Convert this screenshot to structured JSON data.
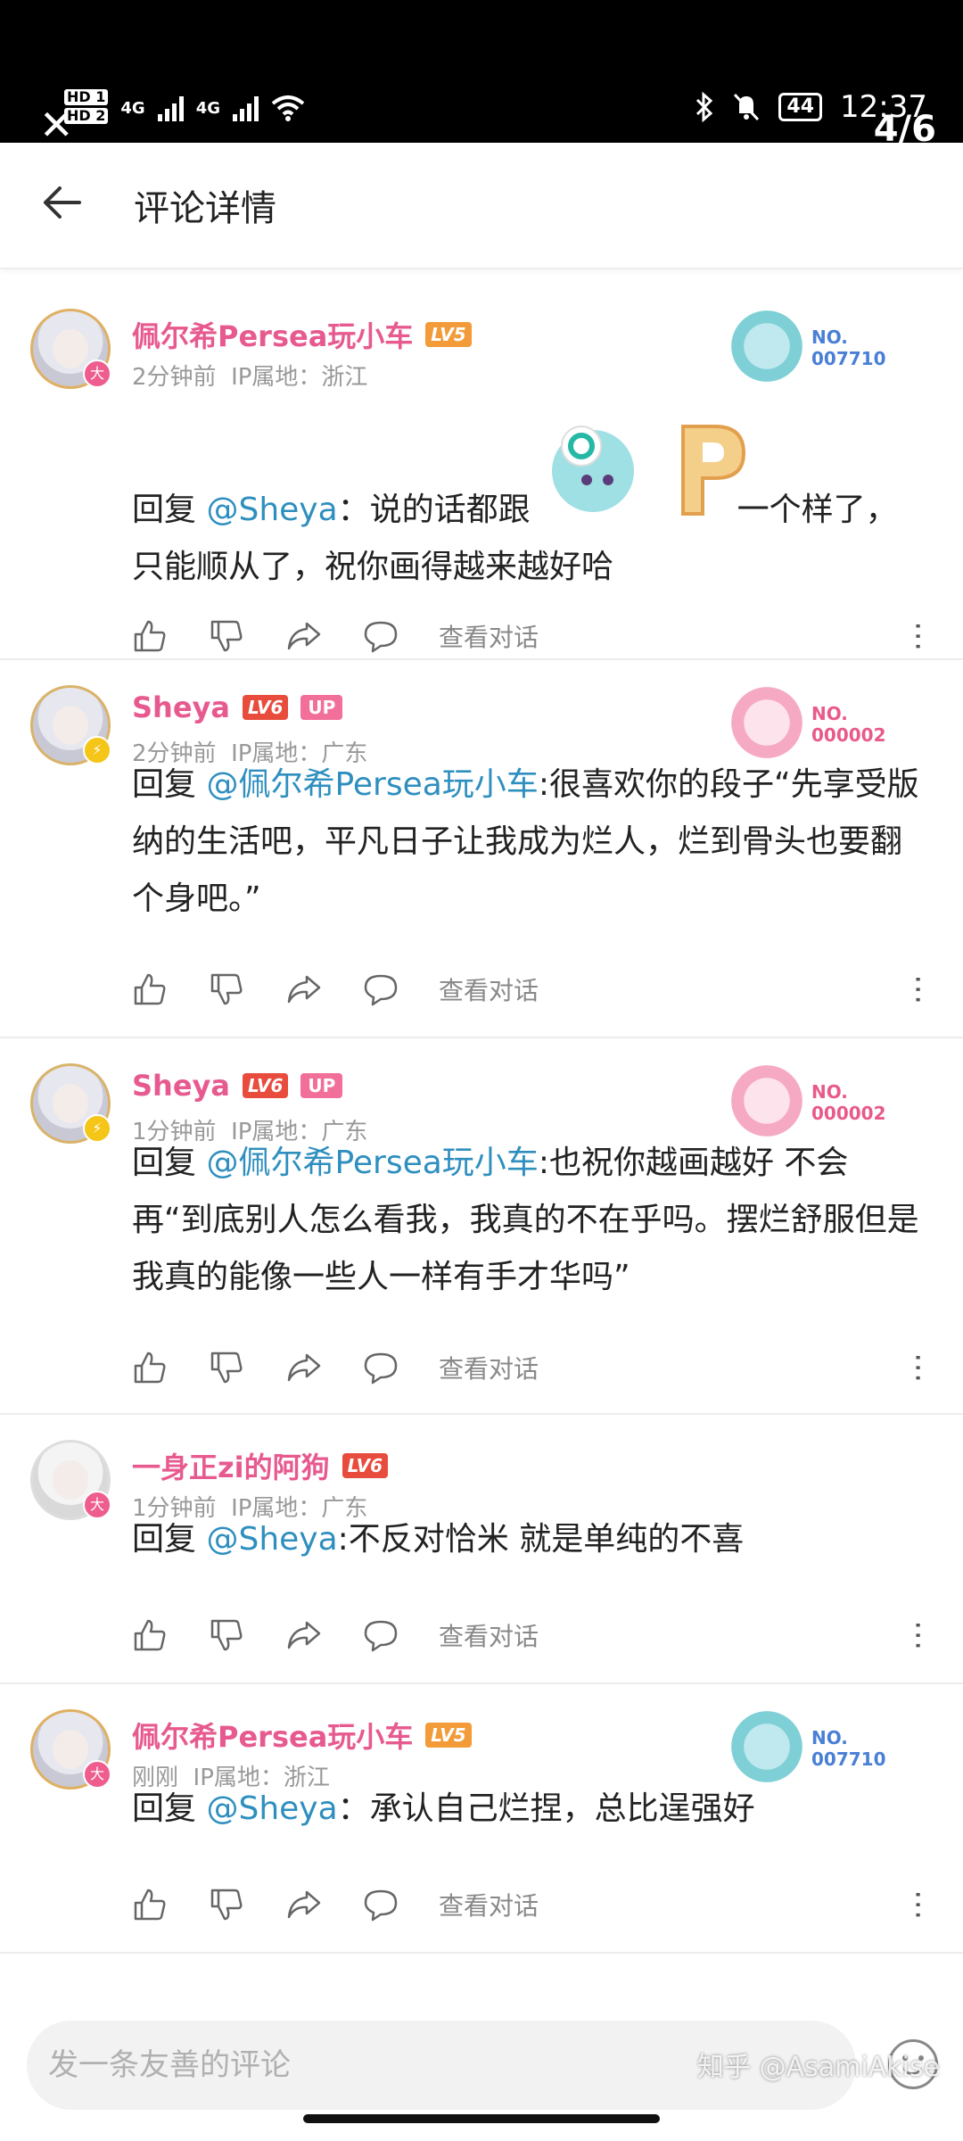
{
  "status_bar": {
    "hd1": "HD 1",
    "hd2": "HD 2",
    "net1": "4G",
    "net2": "4G",
    "battery": "44",
    "time": "12:37",
    "close_icon": "close-icon",
    "image_counter": "4/6"
  },
  "header": {
    "back_icon": "arrow-left-icon",
    "title": "评论详情"
  },
  "comments": [
    {
      "user": "佩尔希Persea玩小车",
      "level": "LV5",
      "level_color": "#f29b38",
      "up": "",
      "time": "2分钟前",
      "ip": "IP属地：浙江",
      "card_no": "NO.\n007710",
      "card_color": "#4a7fd6",
      "reply_label": "回复",
      "mention": "@Sheya",
      "text": "：说的话都跟",
      "text2": "一个样了，只能顺从了，祝你画得越来越好哈",
      "talk": "查看对话"
    },
    {
      "user": "Sheya",
      "level": "LV6",
      "level_color": "#e84c3d",
      "up": "UP",
      "time": "2分钟前",
      "ip": "IP属地：广东",
      "card_no": "NO.\n000002",
      "card_color": "#e85a8a",
      "reply_label": "回复",
      "mention": "@佩尔希Persea玩小车",
      "text": ":很喜欢你的段子“先享受版纳的生活吧，平凡日子让我成为烂人，烂到骨头也要翻个身吧。”",
      "talk": "查看对话"
    },
    {
      "user": "Sheya",
      "level": "LV6",
      "level_color": "#e84c3d",
      "up": "UP",
      "time": "1分钟前",
      "ip": "IP属地：广东",
      "card_no": "NO.\n000002",
      "card_color": "#e85a8a",
      "reply_label": "回复",
      "mention": "@佩尔希Persea玩小车",
      "text": ":也祝你越画越好 不会再“到底别人怎么看我，我真的不在乎吗。摆烂舒服但是我真的能像一些人一样有手才华吗”",
      "talk": "查看对话"
    },
    {
      "user": "一身正zi的阿狗",
      "level": "LV6",
      "level_color": "#e84c3d",
      "up": "",
      "time": "1分钟前",
      "ip": "IP属地：广东",
      "card_no": "",
      "card_color": "",
      "reply_label": "回复",
      "mention": "@Sheya",
      "text": ":不反对恰米 就是单纯的不喜",
      "talk": "查看对话"
    },
    {
      "user": "佩尔希Persea玩小车",
      "level": "LV5",
      "level_color": "#f29b38",
      "up": "",
      "time": "刚刚",
      "ip": "IP属地：浙江",
      "card_no": "NO.\n007710",
      "card_color": "#4a7fd6",
      "reply_label": "回复",
      "mention": "@Sheya",
      "text": "：承认自己烂捏，总比逞强好",
      "talk": "查看对话"
    }
  ],
  "input": {
    "placeholder": "发一条友善的评论",
    "emoji_icon": "smiley-icon"
  },
  "watermark": "知乎 @AsamiAkise",
  "icons": {
    "like": "thumbs-up-icon",
    "dislike": "thumbs-down-icon",
    "share": "share-icon",
    "reply": "comment-bubble-icon",
    "more": "more-vertical-icon"
  }
}
